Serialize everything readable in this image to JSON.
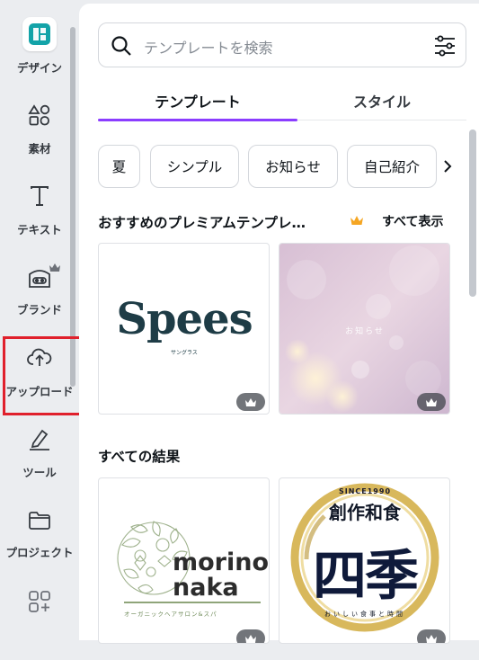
{
  "sidebar": {
    "items": [
      {
        "label": "デザイン"
      },
      {
        "label": "素材"
      },
      {
        "label": "テキスト"
      },
      {
        "label": "ブランド"
      },
      {
        "label": "アップロード"
      },
      {
        "label": "ツール"
      },
      {
        "label": "プロジェクト"
      },
      {
        "label": "アプリ"
      }
    ],
    "highlighted": "アップロード"
  },
  "search": {
    "placeholder": "テンプレートを検索"
  },
  "tabs": [
    {
      "label": "テンプレート",
      "active": true
    },
    {
      "label": "スタイル",
      "active": false
    }
  ],
  "chips": [
    "夏",
    "シンプル",
    "お知らせ",
    "自己紹介"
  ],
  "sections": {
    "premium": {
      "title": "おすすめのプレミアムテンプレ…",
      "see_all": "すべて表示",
      "cards": [
        {
          "text": "Spees",
          "sub": "サングラス",
          "premium": true
        },
        {
          "text": "お知らせ",
          "premium": true
        }
      ]
    },
    "all": {
      "title": "すべての結果",
      "cards": [
        {
          "line1": "morino",
          "line2": "naka",
          "sub": "オーガニックヘアサロン&スパ",
          "premium": true
        },
        {
          "since": "SINCE1990",
          "top": "創作和食",
          "main": "四季",
          "bottom": "おいしい食事と時間",
          "premium": true
        }
      ]
    }
  },
  "colors": {
    "accent": "#8b3dff",
    "highlight": "#e0202c",
    "crown": "#f5a623"
  }
}
